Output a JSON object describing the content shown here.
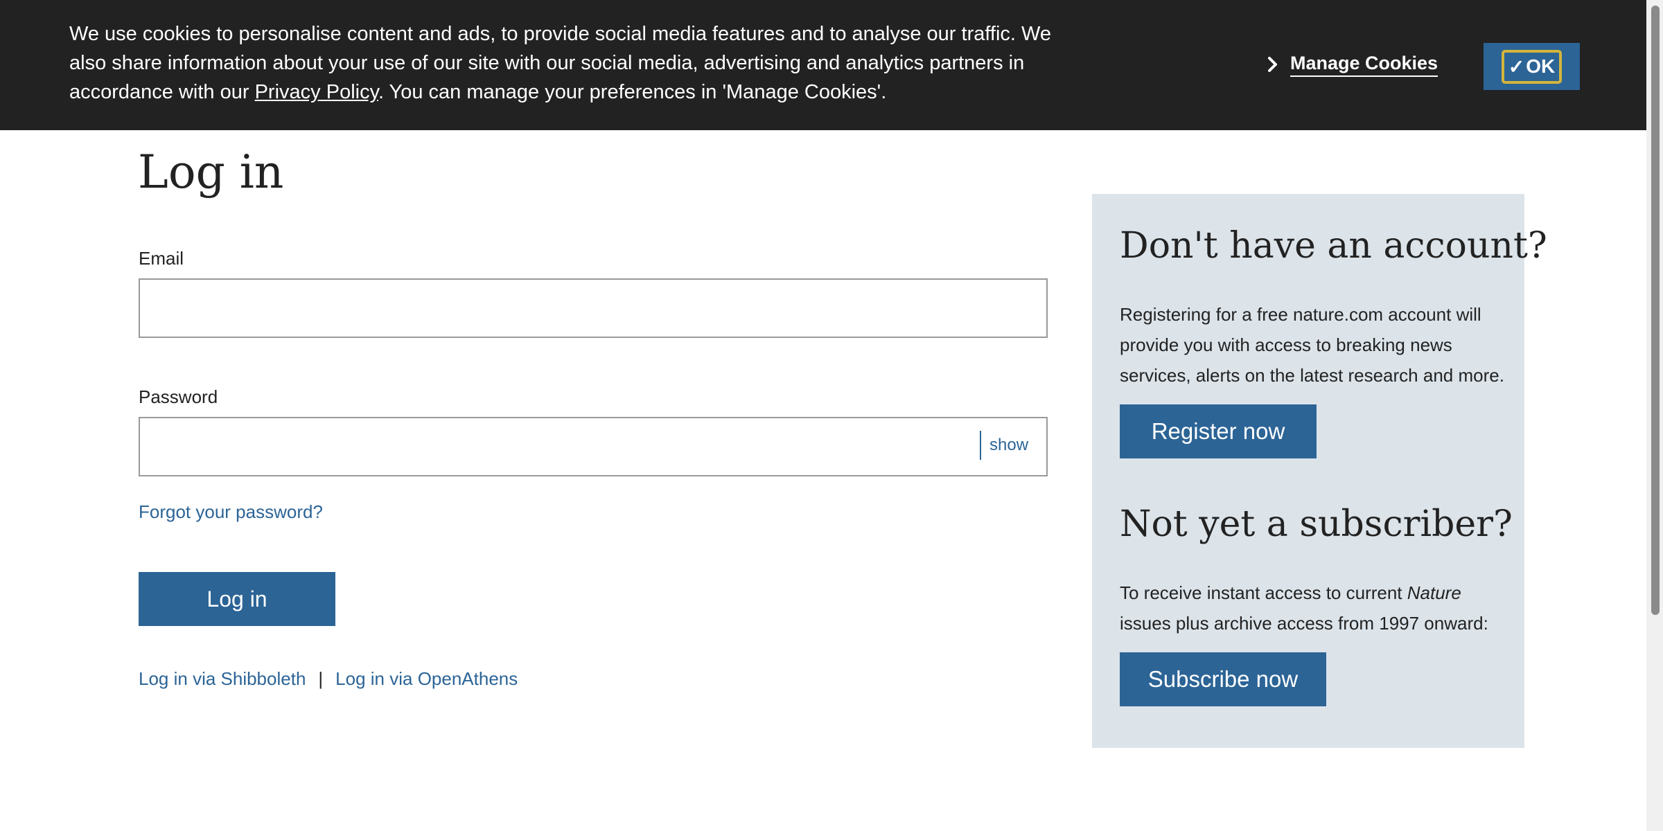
{
  "cookie_banner": {
    "text_before": "We use cookies to personalise content and ads, to provide social media features and to analyse our traffic. We also share information about your use of our site with our social media, advertising and analytics partners in accordance with our ",
    "privacy_link": "Privacy Policy",
    "text_after": ". You can manage your preferences in 'Manage Cookies'.",
    "manage_label": "Manage Cookies",
    "ok_label": "OK",
    "ok_check": "✓"
  },
  "login": {
    "title": "Log in",
    "email_label": "Email",
    "email_value": "",
    "password_label": "Password",
    "password_value": "",
    "show_label": "show",
    "forgot_label": "Forgot your password?",
    "login_button": "Log in",
    "shibboleth_label": "Log in via Shibboleth",
    "separator": "|",
    "openathens_label": "Log in via OpenAthens"
  },
  "sidebar": {
    "register_heading": "Don't have an account?",
    "register_text": "Registering for a free nature.com account will provide you with access to breaking news services, alerts on the latest research and more.",
    "register_button": "Register now",
    "subscribe_heading": "Not yet a subscriber?",
    "subscribe_text_before": "To receive instant access to current ",
    "subscribe_text_italic": "Nature",
    "subscribe_text_after": " issues plus archive access from 1997 onward:",
    "subscribe_button": "Subscribe now"
  },
  "colors": {
    "banner_bg": "#222222",
    "brand_blue": "#2c6496",
    "panel_bg": "#dce4ea",
    "focus_ring": "#d4b53a"
  },
  "icons": {
    "manage_cookies": "chevron-right-icon",
    "ok": "check-icon"
  }
}
